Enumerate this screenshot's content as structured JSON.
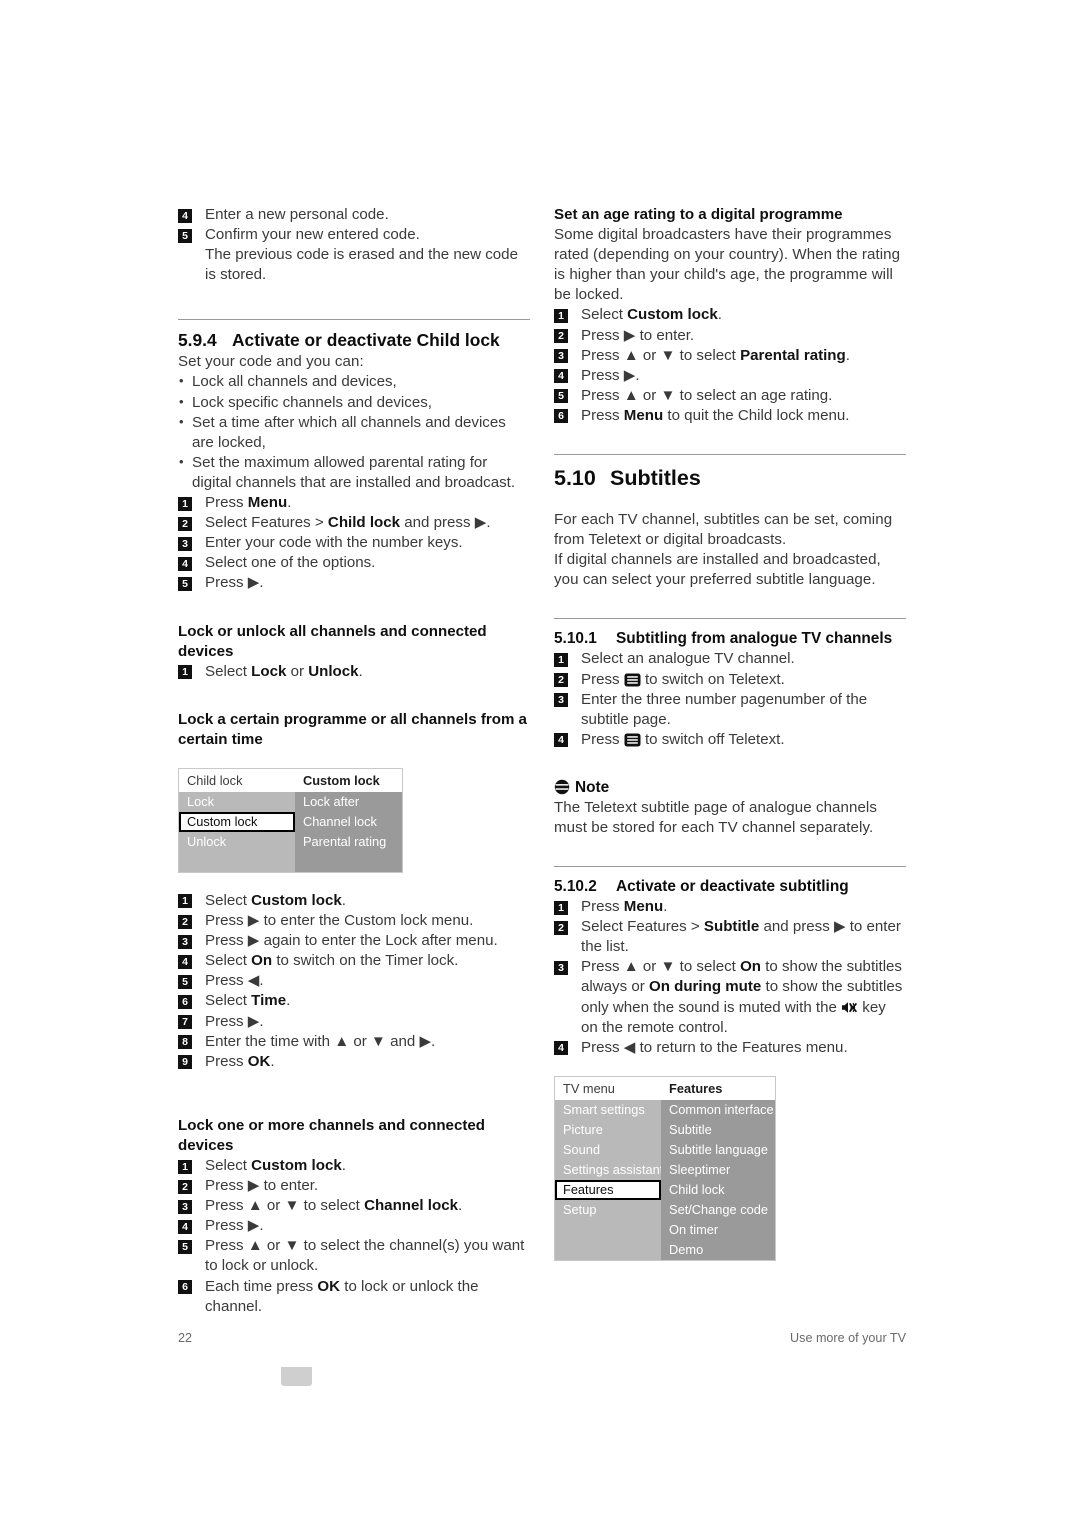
{
  "footer": {
    "page_number": "22",
    "running_title": "Use more of your TV"
  },
  "left_column": {
    "intro_steps": [
      {
        "n": "4",
        "text_parts": [
          {
            "t": "Enter a new personal code.",
            "b": false
          }
        ]
      },
      {
        "n": "5",
        "text_parts": [
          {
            "t": "Confirm your new entered code.",
            "b": false
          }
        ]
      }
    ],
    "intro_continuation": "The previous code is erased and the new code is stored.",
    "section_594": {
      "number": "5.9.4",
      "title": "Activate or deactivate Child lock",
      "lead": "Set your code and you can:",
      "bullets": [
        "Lock all channels and devices,",
        "Lock specific channels and devices,",
        "Set a time after which all channels and devices are locked,",
        "Set the maximum allowed parental rating for digital channels that are installed and broadcast."
      ],
      "steps": [
        {
          "n": "1",
          "plain_before": "Press ",
          "bold": "Menu",
          "plain_after": "."
        },
        {
          "n": "2",
          "plain_before": "Select Features > ",
          "bold": "Child lock",
          "plain_after": " and press ▶."
        },
        {
          "n": "3",
          "plain_before": "Enter your code with the number keys.",
          "bold": "",
          "plain_after": ""
        },
        {
          "n": "4",
          "plain_before": "Select one of the options.",
          "bold": "",
          "plain_after": ""
        },
        {
          "n": "5",
          "plain_before": "Press ▶.",
          "bold": "",
          "plain_after": ""
        }
      ]
    },
    "lock_all": {
      "heading": "Lock or unlock all channels and connected devices",
      "steps": [
        {
          "n": "1",
          "plain_before": "Select ",
          "bold": "Lock",
          "plain_mid": " or ",
          "bold2": "Unlock",
          "plain_after": "."
        }
      ]
    },
    "lock_certain": {
      "heading": "Lock a certain programme or all channels from a certain time"
    },
    "menu_childlock": {
      "header_left": "Child lock",
      "header_right": "Custom lock",
      "left_items": [
        "Lock",
        "Custom lock",
        "Unlock",
        ""
      ],
      "left_selected_index": 1,
      "right_items": [
        "Lock after",
        "Channel lock",
        "Parental rating",
        ""
      ]
    },
    "lock_certain_steps": [
      {
        "n": "1",
        "plain_before": "Select ",
        "bold": "Custom lock",
        "plain_after": "."
      },
      {
        "n": "2",
        "plain_before": "Press ▶ to enter the Custom lock menu.",
        "bold": "",
        "plain_after": ""
      },
      {
        "n": "3",
        "plain_before": "Press ▶ again to enter the Lock after menu.",
        "bold": "",
        "plain_after": ""
      },
      {
        "n": "4",
        "plain_before": "Select ",
        "bold": "On",
        "plain_after": " to switch on the Timer lock."
      },
      {
        "n": "5",
        "plain_before": "Press ◀.",
        "bold": "",
        "plain_after": ""
      },
      {
        "n": "6",
        "plain_before": "Select ",
        "bold": "Time",
        "plain_after": "."
      },
      {
        "n": "7",
        "plain_before": "Press ▶.",
        "bold": "",
        "plain_after": ""
      },
      {
        "n": "8",
        "plain_before": "Enter the time with ▲ or ▼ and ▶.",
        "bold": "",
        "plain_after": ""
      },
      {
        "n": "9",
        "plain_before": "Press ",
        "bold": "OK",
        "plain_after": "."
      }
    ],
    "lock_one_more": {
      "heading": "Lock one or more channels and connected devices",
      "steps": [
        {
          "n": "1",
          "plain_before": "Select ",
          "bold": "Custom lock",
          "plain_after": "."
        },
        {
          "n": "2",
          "plain_before": "Press ▶ to enter.",
          "bold": "",
          "plain_after": ""
        },
        {
          "n": "3",
          "plain_before": "Press ▲ or ▼ to select ",
          "bold": "Channel lock",
          "plain_after": "."
        },
        {
          "n": "4",
          "plain_before": "Press ▶.",
          "bold": "",
          "plain_after": ""
        },
        {
          "n": "5",
          "plain_before": "Press ▲ or ▼ to select the channel(s) you want to lock or unlock.",
          "bold": "",
          "plain_after": ""
        },
        {
          "n": "6",
          "plain_before": "Each time press ",
          "bold": "OK",
          "plain_after": " to lock or unlock the channel."
        }
      ]
    }
  },
  "right_column": {
    "age_rating": {
      "heading": "Set an age rating to a digital programme",
      "body": "Some digital broadcasters have their programmes rated (depending on your country). When the rating is higher than your child's age, the programme will be locked.",
      "steps": [
        {
          "n": "1",
          "plain_before": "Select ",
          "bold": "Custom lock",
          "plain_after": "."
        },
        {
          "n": "2",
          "plain_before": "Press ▶ to enter.",
          "bold": "",
          "plain_after": ""
        },
        {
          "n": "3",
          "plain_before": "Press ▲ or ▼ to select ",
          "bold": "Parental rating",
          "plain_after": "."
        },
        {
          "n": "4",
          "plain_before": "Press ▶.",
          "bold": "",
          "plain_after": ""
        },
        {
          "n": "5",
          "plain_before": "Press ▲ or ▼ to select an age rating.",
          "bold": "",
          "plain_after": ""
        },
        {
          "n": "6",
          "plain_before": "Press ",
          "bold": "Menu",
          "plain_after": " to quit the Child lock menu."
        }
      ]
    },
    "section_510": {
      "number": "5.10",
      "title": "Subtitles",
      "body_1": "For each TV channel, subtitles can be set, coming from Teletext or digital broadcasts.",
      "body_2": "If digital channels are installed and broadcasted, you can select your preferred subtitle language."
    },
    "section_5101": {
      "number": "5.10.1",
      "title": "Subtitling from analogue TV channels",
      "step1": "Select an analogue TV channel.",
      "step2_before": "Press ",
      "step2_after": " to switch on Teletext.",
      "step3": "Enter the three number pagenumber of the subtitle page.",
      "step4_before": "Press ",
      "step4_after": " to switch off Teletext.",
      "nums": [
        "1",
        "2",
        "3",
        "4"
      ]
    },
    "note": {
      "label": "Note",
      "body": "The Teletext subtitle page of analogue channels must be stored for each TV channel separately."
    },
    "section_5102": {
      "number": "5.10.2",
      "title": "Activate or deactivate subtitling",
      "steps": [
        {
          "n": "1",
          "plain_before": "Press ",
          "bold": "Menu",
          "plain_after": "."
        },
        {
          "n": "2",
          "plain_before": "Select Features > ",
          "bold": "Subtitle",
          "plain_after": " and press ▶ to enter the list."
        }
      ],
      "step3_num": "3",
      "step3_a": "Press ▲ or ▼ to select ",
      "step3_on": "On",
      "step3_b": " to show the subtitles always or ",
      "step3_odm": "On during mute",
      "step3_c": " to show the subtitles only when the sound is muted with the ",
      "step3_d": " key on the remote control.",
      "step4_num": "4",
      "step4": "Press ◀ to return to the Features menu."
    },
    "menu_tv": {
      "header_left": "TV menu",
      "header_right": "Features",
      "left_items": [
        "Smart settings",
        "Picture",
        "Sound",
        "Settings assistant",
        "Features",
        "Setup",
        ""
      ],
      "left_selected_index": 4,
      "right_items": [
        "Common interface",
        "Subtitle",
        "Subtitle language",
        "Sleeptimer",
        "Child lock",
        "Set/Change code",
        "On timer",
        "Demo"
      ]
    }
  },
  "colors": {
    "menu_left_bg": "#b9b9b9",
    "menu_right_bg": "#9a9a9a",
    "menu_selected_bg": "#ffffff",
    "marker_bg": "#111111",
    "rule": "#9b9b9b"
  }
}
